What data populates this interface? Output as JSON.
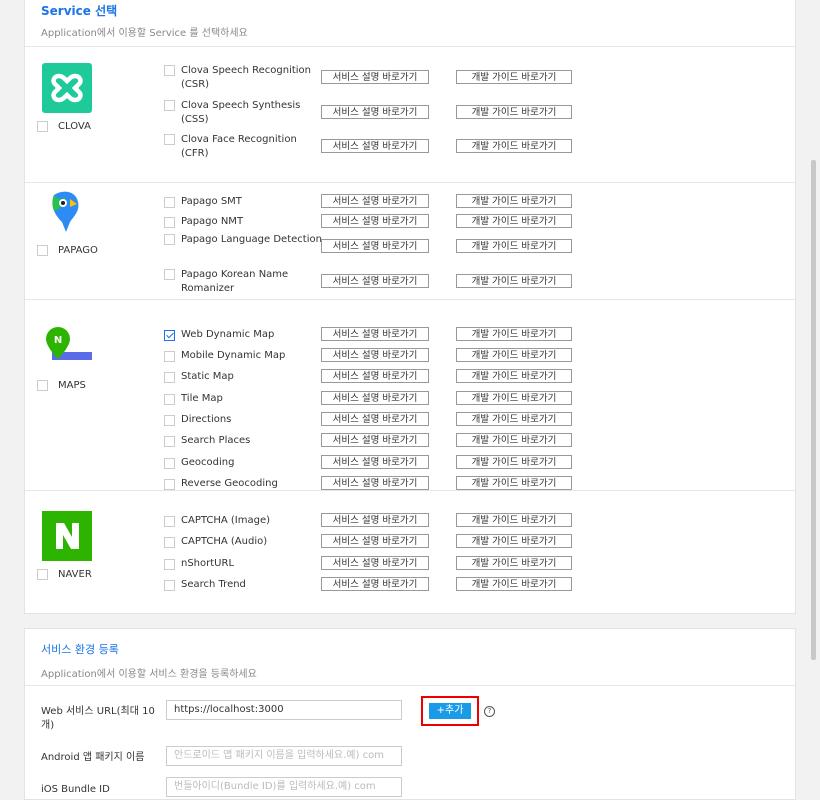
{
  "service_select": {
    "title": "Service 선택",
    "subtitle": "Application에서 이용할 Service 를 선택하세요"
  },
  "link_labels": {
    "desc": "서비스 설명 바로가기",
    "guide": "개발 가이드 바로가기"
  },
  "brands": [
    {
      "label": "CLOVA",
      "checked": false,
      "icon": "clova-logo-icon",
      "color": "#1ec99a",
      "services": [
        {
          "name": "Clova Speech Recognition (CSR)",
          "checked": false
        },
        {
          "name": "Clova Speech Synthesis (CSS)",
          "checked": false
        },
        {
          "name": "Clova Face Recognition (CFR)",
          "checked": false
        }
      ]
    },
    {
      "label": "PAPAGO",
      "checked": false,
      "icon": "papago-logo-icon",
      "color": "#2c8cf4",
      "services": [
        {
          "name": "Papago SMT",
          "checked": false
        },
        {
          "name": "Papago NMT",
          "checked": false
        },
        {
          "name": "Papago Language Detection",
          "checked": false
        },
        {
          "name": "Papago Korean Name Romanizer",
          "checked": false
        }
      ]
    },
    {
      "label": "MAPS",
      "checked": false,
      "icon": "maps-logo-icon",
      "color": "#2db400",
      "services": [
        {
          "name": "Web Dynamic Map",
          "checked": true
        },
        {
          "name": "Mobile Dynamic Map",
          "checked": false
        },
        {
          "name": "Static Map",
          "checked": false
        },
        {
          "name": "Tile Map",
          "checked": false
        },
        {
          "name": "Directions",
          "checked": false
        },
        {
          "name": "Search Places",
          "checked": false
        },
        {
          "name": "Geocoding",
          "checked": false
        },
        {
          "name": "Reverse Geocoding",
          "checked": false
        }
      ]
    },
    {
      "label": "NAVER",
      "checked": false,
      "icon": "naver-logo-icon",
      "color": "#2db400",
      "services": [
        {
          "name": "CAPTCHA (Image)",
          "checked": false
        },
        {
          "name": "CAPTCHA (Audio)",
          "checked": false
        },
        {
          "name": "nShortURL",
          "checked": false
        },
        {
          "name": "Search Trend",
          "checked": false
        }
      ]
    }
  ],
  "env": {
    "title": "서비스 환경 등록",
    "subtitle": "Application에서 이용할 서비스 환경을 등록하세요",
    "web_label": "Web 서비스 URL(최대 10개)",
    "web_value": "https://localhost:3000",
    "add_label": "+추가",
    "help": "?",
    "android_label": "Android 앱 패키지 이름",
    "android_placeholder": "안드로이드 앱 패키지 이름을 입력하세요.예) com",
    "ios_label": "iOS Bundle ID",
    "ios_placeholder": "번들아이디(Bundle ID)를 입력하세요.예) com"
  }
}
